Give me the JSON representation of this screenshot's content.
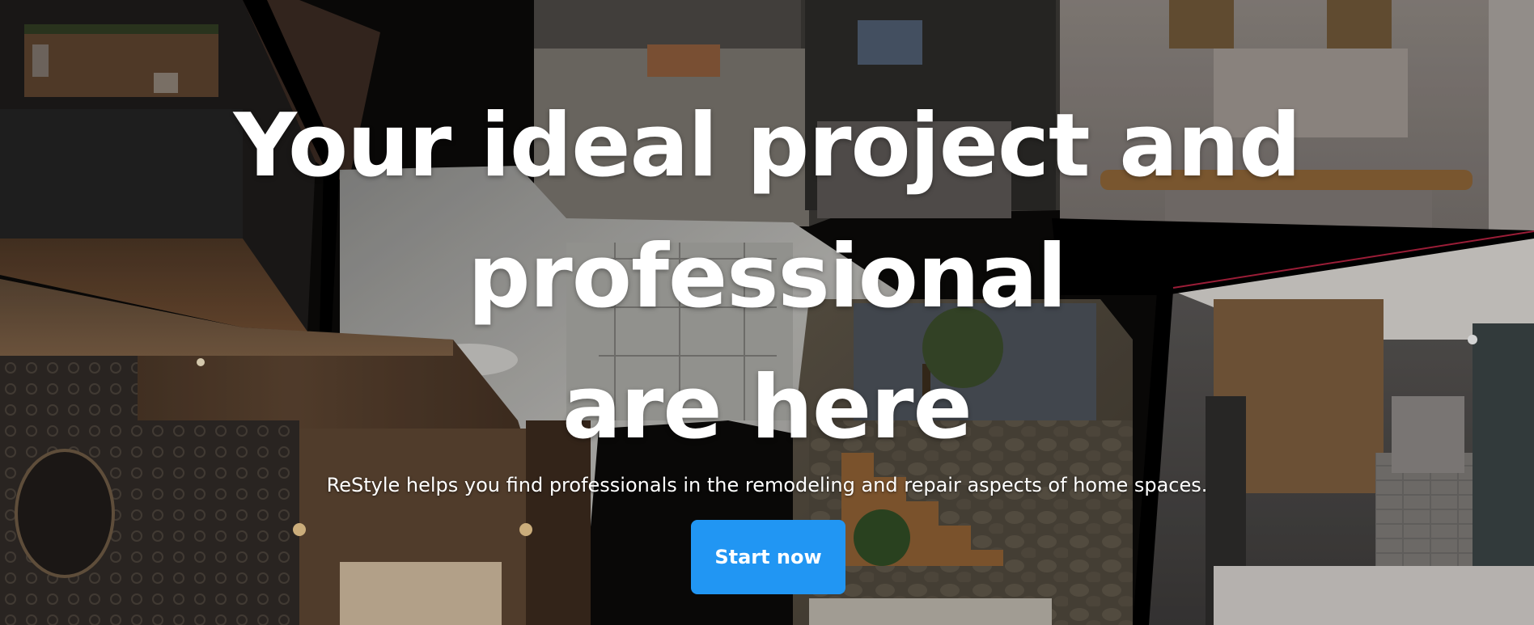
{
  "hero": {
    "title_lines": [
      "Your ideal project and",
      "professional",
      "are here"
    ],
    "subtitle": "ReStyle helps you find professionals in the remodeling and repair aspects of home spaces.",
    "cta_label": "Start now"
  },
  "colors": {
    "cta_background": "#2196f3",
    "text": "#ffffff",
    "backdrop": "#0b0a09"
  },
  "collage": {
    "photos": [
      "dark-kitchen-photo",
      "bedroom-office-photo",
      "bright-kitchen-photo",
      "interior-sketch-photo",
      "luxury-bedroom-photo",
      "staircase-garden-photo",
      "modern-kitchen-photo"
    ]
  }
}
